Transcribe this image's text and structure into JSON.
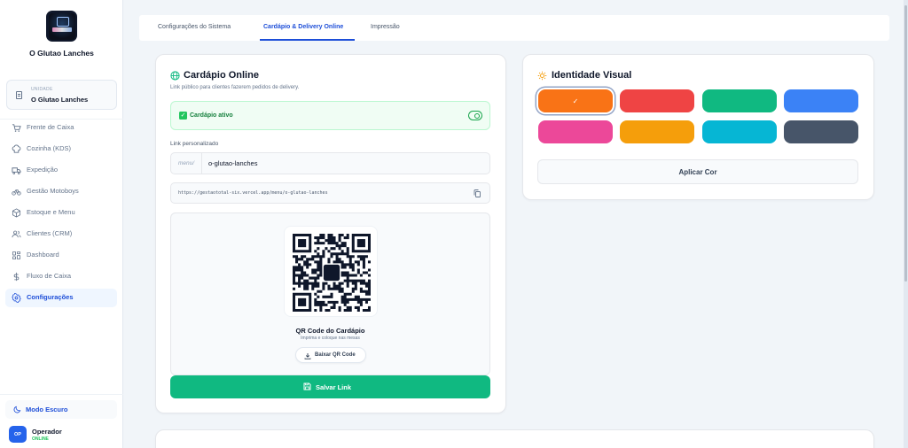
{
  "sidebar": {
    "brand": "O Glutao Lanches",
    "unit_caption": "UNIDADE",
    "unit_name": "O Glutao Lanches",
    "items": [
      {
        "label": "Frente de Caixa",
        "icon": "cart-icon"
      },
      {
        "label": "Cozinha (KDS)",
        "icon": "chef-hat-icon"
      },
      {
        "label": "Expedição",
        "icon": "truck-icon"
      },
      {
        "label": "Gestão Motoboys",
        "icon": "bike-icon"
      },
      {
        "label": "Estoque e Menu",
        "icon": "box-icon"
      },
      {
        "label": "Clientes (CRM)",
        "icon": "users-icon"
      },
      {
        "label": "Dashboard",
        "icon": "grid-icon"
      },
      {
        "label": "Fluxo de Caixa",
        "icon": "dollar-icon"
      },
      {
        "label": "Configurações",
        "icon": "gear-icon",
        "active": true
      }
    ],
    "dark_mode_label": "Modo Escuro",
    "operator": {
      "initials": "OP",
      "name": "Operador",
      "status": "ONLINE"
    }
  },
  "tabs": [
    {
      "label": "Configurações do Sistema"
    },
    {
      "label": "Cardápio & Delivery Online",
      "active": true
    },
    {
      "label": "Impressão"
    }
  ],
  "menu_card": {
    "title": "Cardápio Online",
    "subtitle": "Link público para clientes fazerem pedidos de delivery.",
    "active_label": "Cardápio ativo",
    "active_enabled": true,
    "link_label": "Link personalizado",
    "link_prefix": "menu/",
    "link_value": "o-glutao-lanches",
    "full_url": "https://gestaototal-six.vercel.app/menu/o-glutao-lanches",
    "qr_title": "QR Code do Cardápio",
    "qr_subtitle": "Imprima e coloque nas mesas",
    "download_label": "Baixar QR Code",
    "save_label": "Salvar Link"
  },
  "identity_card": {
    "title": "Identidade Visual",
    "colors": [
      "#f97316",
      "#ef4444",
      "#10b981",
      "#3b82f6",
      "#ec4899",
      "#f59e0b",
      "#06b6d4",
      "#475569"
    ],
    "selected_color": "#f97316",
    "apply_label": "Aplicar Cor"
  },
  "accent": "#1d4ed8",
  "success": "#10b981"
}
